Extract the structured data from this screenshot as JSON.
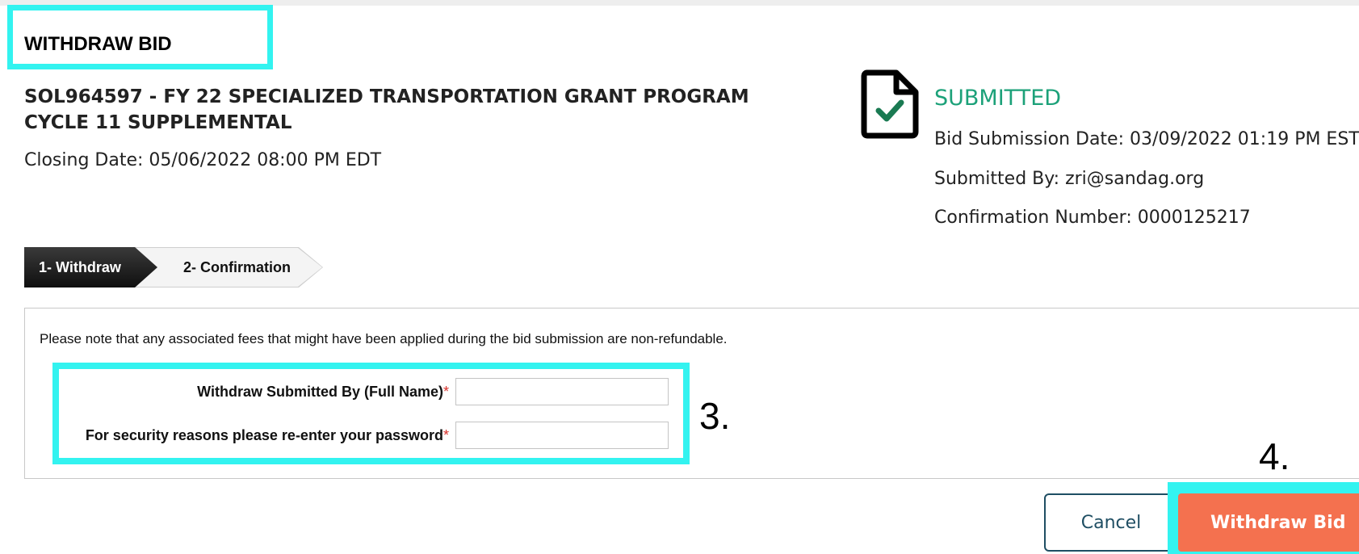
{
  "header": {
    "title": "WITHDRAW BID"
  },
  "solicitation": {
    "title": "SOL964597 - FY 22 SPECIALIZED TRANSPORTATION GRANT PROGRAM CYCLE 11 SUPPLEMENTAL",
    "closing_date": "Closing Date: 05/06/2022 08:00 PM EDT"
  },
  "status": {
    "icon": "document-check-icon",
    "label": "SUBMITTED",
    "color": "#1ca179",
    "submission_date": "Bid Submission Date: 03/09/2022 01:19 PM EST",
    "submitted_by": "Submitted By: zri@sandag.org",
    "confirmation_number": "Confirmation Number: 0000125217"
  },
  "stepper": {
    "steps": [
      {
        "label": "1- Withdraw",
        "active": true
      },
      {
        "label": "2- Confirmation",
        "active": false
      }
    ]
  },
  "form": {
    "note": "Please note that any associated fees that might have been applied during the bid submission are non-refundable.",
    "full_name_label": "Withdraw Submitted By (Full Name)",
    "password_label": "For security reasons please re-enter your password",
    "required_marker": "*",
    "full_name_value": "",
    "password_value": ""
  },
  "annotations": {
    "step3": "3.",
    "step4": "4.",
    "highlight_color": "#33f3f0"
  },
  "actions": {
    "cancel_label": "Cancel",
    "withdraw_label": "Withdraw Bid",
    "withdraw_color": "#f4714f"
  }
}
